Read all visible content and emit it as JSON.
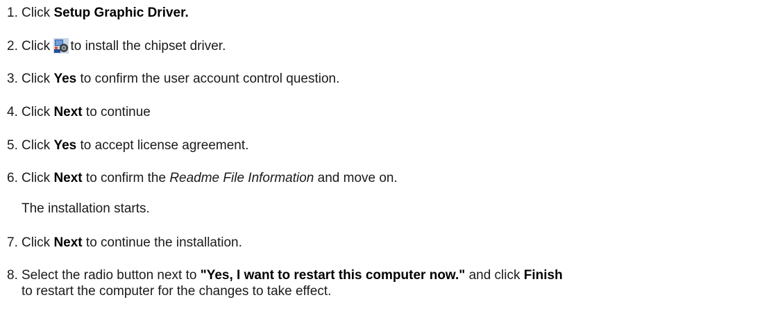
{
  "steps": [
    {
      "num": "1.",
      "pre": "Click ",
      "bold": "Setup Graphic Driver.",
      "post": ""
    },
    {
      "num": "2.",
      "pre": "Click ",
      "icon": "driver-install-icon",
      "post": "to install the chipset driver."
    },
    {
      "num": "3.",
      "pre": "Click ",
      "bold": "Yes",
      "post": " to confirm the user account control question."
    },
    {
      "num": "4.",
      "pre": "Click ",
      "bold": "Next",
      "post": " to continue"
    },
    {
      "num": "5.",
      "pre": "Click ",
      "bold": "Yes",
      "post": " to accept license agreement."
    },
    {
      "num": "6.",
      "pre": "Click ",
      "bold": "Next",
      "mid": " to confirm the ",
      "italic": "Readme File Information",
      "post": " and move on."
    },
    {
      "note": "The installation starts."
    },
    {
      "num": "7.",
      "pre": "Click ",
      "bold": "Next",
      "post": " to continue the installation."
    },
    {
      "num": "8.",
      "pre": "Select the radio button next to ",
      "bold": "\"Yes, I want to restart this computer now.\"",
      "mid": " and click ",
      "bold2": "Finish",
      "post": "",
      "line2": "to restart the computer for the changes to take effect."
    }
  ]
}
